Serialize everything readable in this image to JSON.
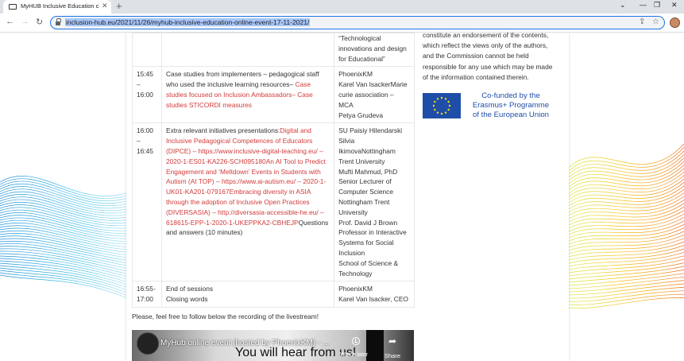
{
  "browser": {
    "tab_title": "MyHUB Inclusive Education onlin",
    "new_tab_label": "+",
    "url": "inclusion-hub.eu/2021/11/26/myhub-inclusive-education-online-event-17-11-2021/"
  },
  "schedule": {
    "rows": [
      {
        "time": "",
        "title_plain": "",
        "title_link": "",
        "who": [
          "“Technological",
          "innovations and design",
          "for Educational”"
        ]
      },
      {
        "time": "15:45 – 16:00",
        "title_plain": "Case studies from implementers – pedagogical staff who used the inclusive learning resources– ",
        "title_link": "Case studies focused on Inclusion Ambassadors– Case studies STICORDI measures",
        "who": [
          "PhoenixKM",
          "Karel Van IsackerMarie",
          "curie association – MCA",
          "Petya Grudeva"
        ]
      },
      {
        "time": "16:00 – 16:45",
        "title_plain": "Extra relevant initiatives presentations:",
        "title_link": "Digital and Inclusive Pedagogical Competences of Educators (DIPCE) – https://www.inclusive-digital-teaching.eu/ – 2020-1-ES01-KA226-SCH095180An AI Tool to Predict Engagement and ‘Meltdown’ Events in Students with Autism (AI TOP) – https://www.ai-autism.eu/ – 2020-1-UK01-KA201-079167Embracing diversity in ASIA through the adoption of Inclusive Open Practices (DIVERSASIA) – http://diversasia-accessible-he.eu/ – 618615-EPP-1-2020-1-UKEPPKA2-CBHEJP",
        "title_tail": "Questions and answers (10 minutes)",
        "who": [
          "SU Paisiy Hilendarski",
          "Silvia",
          "IkimovaNottingham",
          "Trent University",
          "Mufti Mahmud, PhD",
          "Senior Lecturer of",
          "Computer Science",
          "Nottingham Trent",
          "University",
          "Prof. David J Brown",
          "Professor in Interactive",
          "Systems for Social",
          "Inclusion",
          "School of Science &",
          "Technology"
        ]
      },
      {
        "time": "16:55- 17:00",
        "title_lines": [
          "End of sessions",
          "Closing words"
        ],
        "who": [
          "PhoenixKM",
          "Karel Van Isacker, CEO"
        ]
      }
    ]
  },
  "sidebar": {
    "disclaimer_lines": [
      "constitute an endorsement of the contents,",
      "which reflect the views only of the authors,",
      "and the Commission cannot be held",
      "responsible for any use which may be made",
      "of the information contained therein."
    ],
    "eu_lines": [
      "Co-funded by the",
      "Erasmus+ Programme",
      "of the European Union"
    ],
    "eu_flag_color": "#1f4ea8",
    "eu_star_color": "#ffdd00"
  },
  "below": {
    "follow_text": "Please, feel free to follow below the recording of the livestream!"
  },
  "video": {
    "title": "MyHub online event (hosted by PhoenixKM) - ...",
    "overlay_text": "You will hear from us!",
    "watch_later": "Watch later",
    "share": "Share"
  },
  "colors": {
    "link_red": "#d33a3a",
    "omnibox_border": "#1a73e8",
    "url_highlight": "#a8c7fa"
  }
}
